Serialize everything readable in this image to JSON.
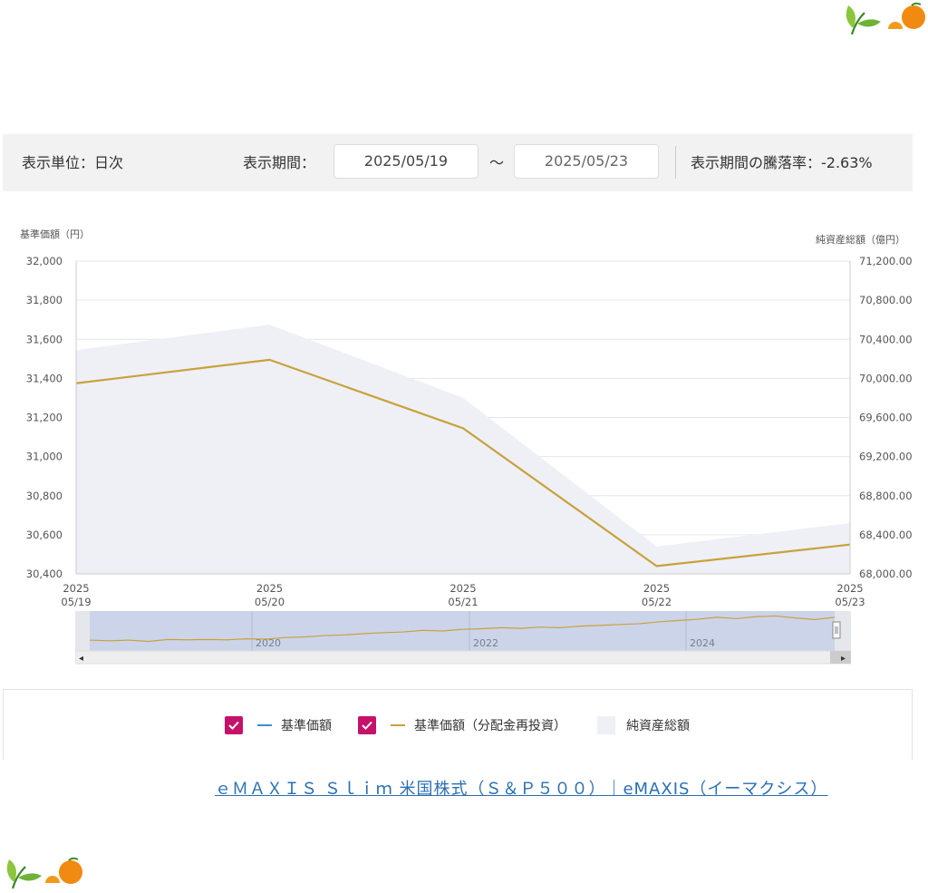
{
  "controls": {
    "unit_label": "表示単位：日次",
    "period_label": "表示期間：",
    "start_date": "2025/05/19",
    "tilde": "～",
    "end_date": "2025/05/23",
    "change_label": "表示期間の騰落率：-2.63%"
  },
  "chart_data": {
    "type": "line",
    "x": [
      "2025/05/19",
      "2025/05/20",
      "2025/05/21",
      "2025/05/22",
      "2025/05/23"
    ],
    "x_tick_labels": [
      {
        "year": "2025",
        "md": "05/19"
      },
      {
        "year": "2025",
        "md": "05/20"
      },
      {
        "year": "2025",
        "md": "05/21"
      },
      {
        "year": "2025",
        "md": "05/22"
      },
      {
        "year": "2025",
        "md": "05/23"
      }
    ],
    "y_left_label": "基準価額（円）",
    "y_right_label": "純資産総額（億円）",
    "y_left_lim": [
      30400,
      32000
    ],
    "y_right_lim": [
      68000,
      71200
    ],
    "y_left_ticks": [
      "32,000",
      "31,800",
      "31,600",
      "31,400",
      "31,200",
      "31,000",
      "30,800",
      "30,600",
      "30,400"
    ],
    "y_right_ticks": [
      "71,200.00",
      "70,800.00",
      "70,400.00",
      "70,000.00",
      "69,600.00",
      "69,200.00",
      "68,800.00",
      "68,400.00",
      "68,000.00"
    ],
    "grid": true,
    "series": [
      {
        "name": "基準価額（分配金再投資）",
        "axis": "left",
        "kind": "line",
        "color": "#c9a13d",
        "values": [
          31375,
          31495,
          31145,
          30440,
          30550
        ]
      },
      {
        "name": "純資産総額",
        "axis": "right",
        "kind": "area",
        "color": "#eef0f5",
        "values": [
          70290,
          70550,
          69800,
          68280,
          68520
        ]
      }
    ]
  },
  "navigator": {
    "year_labels": [
      "2020",
      "2022",
      "2024"
    ],
    "mini_values": [
      0.22,
      0.2,
      0.22,
      0.18,
      0.24,
      0.23,
      0.24,
      0.23,
      0.26,
      0.25,
      0.3,
      0.32,
      0.36,
      0.38,
      0.42,
      0.45,
      0.47,
      0.52,
      0.5,
      0.55,
      0.57,
      0.6,
      0.58,
      0.62,
      0.6,
      0.65,
      0.67,
      0.7,
      0.72,
      0.78,
      0.82,
      0.86,
      0.92,
      0.88,
      0.94,
      0.96,
      0.9,
      0.85,
      0.92
    ],
    "left_arrow": "◂",
    "right_arrow": "▸"
  },
  "legend": {
    "item1": "基準価額",
    "item2": "基準価額（分配金再投資）",
    "item3": "純資産総額",
    "item1_color": "#3b8fd4",
    "item2_color": "#c9a13d",
    "check_color": "#c4126b"
  },
  "footer": {
    "link_text": "ｅＭＡＸＩＳ Ｓｌｉｍ 米国株式（Ｓ＆Ｐ５００）｜eMAXIS（イーマクシス）"
  }
}
